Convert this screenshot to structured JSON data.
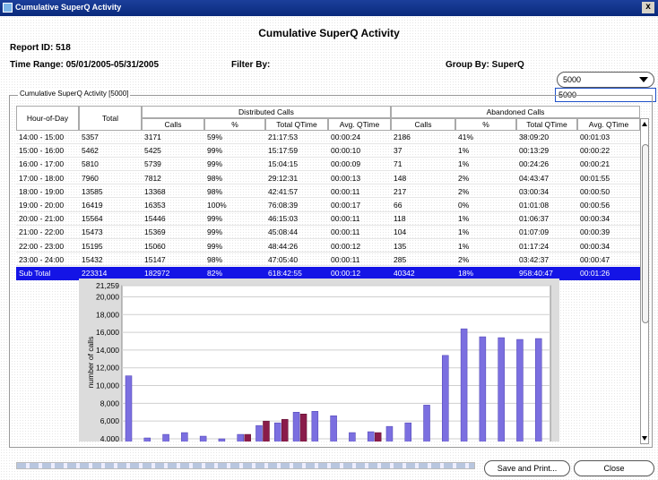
{
  "window": {
    "title": "Cumulative SuperQ Activity",
    "close_glyph": "x"
  },
  "report": {
    "title": "Cumulative SuperQ Activity",
    "report_id": "Report ID: 518",
    "time_range": "Time Range: 05/01/2005-05/31/2005",
    "filter_by": "Filter By:",
    "group_by": "Group By: SuperQ"
  },
  "dropdown": {
    "selected": "5000",
    "options": [
      "5000"
    ]
  },
  "group_label": "Cumulative SuperQ Activity [5000]",
  "table": {
    "headers": {
      "hour": "Hour-of-Day",
      "total": "Total",
      "distributed": "Distributed Calls",
      "abandoned": "Abandoned Calls",
      "calls": "Calls",
      "pct": "%",
      "total_qtime": "Total QTime",
      "avg_qtime": "Avg. QTime"
    },
    "rows": [
      [
        "14:00 - 15:00",
        "5357",
        "3171",
        "59%",
        "21:17:53",
        "00:00:24",
        "2186",
        "41%",
        "38:09:20",
        "00:01:03"
      ],
      [
        "15:00 - 16:00",
        "5462",
        "5425",
        "99%",
        "15:17:59",
        "00:00:10",
        "37",
        "1%",
        "00:13:29",
        "00:00:22"
      ],
      [
        "16:00 - 17:00",
        "5810",
        "5739",
        "99%",
        "15:04:15",
        "00:00:09",
        "71",
        "1%",
        "00:24:26",
        "00:00:21"
      ],
      [
        "17:00 - 18:00",
        "7960",
        "7812",
        "98%",
        "29:12:31",
        "00:00:13",
        "148",
        "2%",
        "04:43:47",
        "00:01:55"
      ],
      [
        "18:00 - 19:00",
        "13585",
        "13368",
        "98%",
        "42:41:57",
        "00:00:11",
        "217",
        "2%",
        "03:00:34",
        "00:00:50"
      ],
      [
        "19:00 - 20:00",
        "16419",
        "16353",
        "100%",
        "76:08:39",
        "00:00:17",
        "66",
        "0%",
        "01:01:08",
        "00:00:56"
      ],
      [
        "20:00 - 21:00",
        "15564",
        "15446",
        "99%",
        "46:15:03",
        "00:00:11",
        "118",
        "1%",
        "01:06:37",
        "00:00:34"
      ],
      [
        "21:00 - 22:00",
        "15473",
        "15369",
        "99%",
        "45:08:44",
        "00:00:11",
        "104",
        "1%",
        "01:07:09",
        "00:00:39"
      ],
      [
        "22:00 - 23:00",
        "15195",
        "15060",
        "99%",
        "48:44:26",
        "00:00:12",
        "135",
        "1%",
        "01:17:24",
        "00:00:34"
      ],
      [
        "23:00 - 24:00",
        "15432",
        "15147",
        "98%",
        "47:05:40",
        "00:00:11",
        "285",
        "2%",
        "03:42:37",
        "00:00:47"
      ]
    ],
    "subtotal": [
      "Sub Total",
      "223314",
      "182972",
      "82%",
      "618:42:55",
      "00:00:12",
      "40342",
      "18%",
      "958:40:47",
      "00:01:26"
    ]
  },
  "chart_data": {
    "type": "bar",
    "ylabel": "number of calls",
    "y_ticks": [
      "21,259",
      "20,000",
      "18,000",
      "16,000",
      "14,000",
      "12,000",
      "10,000",
      "8,000",
      "6,000",
      "4,000"
    ],
    "ylim": [
      4000,
      21259
    ],
    "grid": true,
    "legend": "none",
    "series": [
      {
        "color": "#7b6fe0",
        "values": [
          11100,
          4100,
          4500,
          4700,
          4300,
          4000,
          4500,
          5500,
          5800,
          7000,
          7100,
          6600,
          4700,
          4800,
          5400,
          5800,
          7800,
          13400,
          16400,
          15500,
          15400,
          15200,
          15300
        ]
      },
      {
        "color": "#8a1c4a",
        "values": [
          0,
          0,
          0,
          0,
          3400,
          3300,
          4500,
          6000,
          6200,
          6800,
          0,
          0,
          0,
          4700,
          0,
          0,
          0,
          0,
          0,
          0,
          0,
          0,
          0
        ]
      }
    ]
  },
  "buttons": {
    "save": "Save and Print...",
    "close": "Close"
  }
}
